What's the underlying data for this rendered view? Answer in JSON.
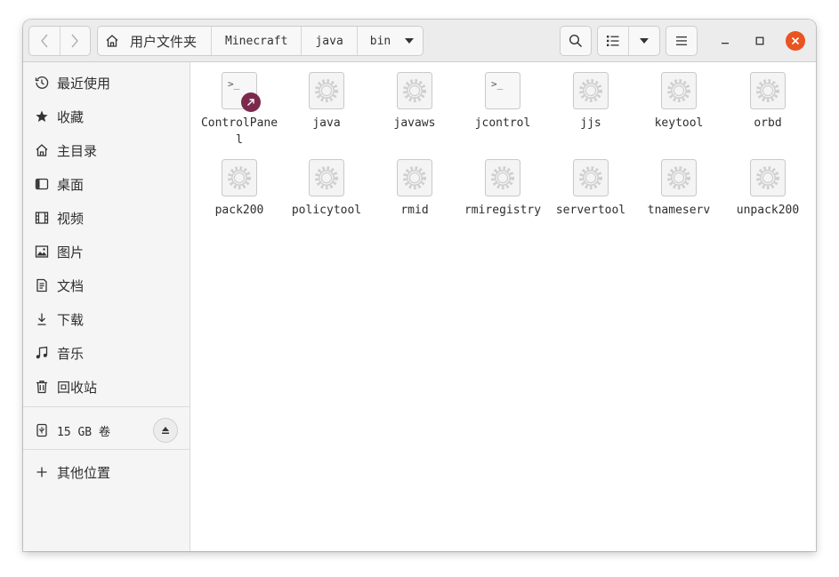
{
  "header": {
    "path": {
      "home_label": "用户文件夹",
      "segments": [
        "Minecraft",
        "java"
      ],
      "current": "bin"
    }
  },
  "sidebar": {
    "items": [
      {
        "label": "最近使用",
        "icon": "clock-icon"
      },
      {
        "label": "收藏",
        "icon": "star-icon"
      },
      {
        "label": "主目录",
        "icon": "home-icon"
      },
      {
        "label": "桌面",
        "icon": "desktop-icon"
      },
      {
        "label": "视频",
        "icon": "film-icon"
      },
      {
        "label": "图片",
        "icon": "image-icon"
      },
      {
        "label": "文档",
        "icon": "document-icon"
      },
      {
        "label": "下载",
        "icon": "download-icon"
      },
      {
        "label": "音乐",
        "icon": "music-icon"
      },
      {
        "label": "回收站",
        "icon": "trash-icon"
      }
    ],
    "volume": {
      "label": "15 GB 卷",
      "icon": "usb-drive-icon"
    },
    "other_locations": {
      "label": "其他位置",
      "icon": "plus-icon"
    }
  },
  "files": [
    {
      "name": "ControlPanel",
      "icon": "terminal-icon",
      "symlink": true
    },
    {
      "name": "java",
      "icon": "executable-icon"
    },
    {
      "name": "javaws",
      "icon": "executable-icon"
    },
    {
      "name": "jcontrol",
      "icon": "terminal-icon"
    },
    {
      "name": "jjs",
      "icon": "executable-icon"
    },
    {
      "name": "keytool",
      "icon": "executable-icon"
    },
    {
      "name": "orbd",
      "icon": "executable-icon"
    },
    {
      "name": "pack200",
      "icon": "executable-icon"
    },
    {
      "name": "policytool",
      "icon": "executable-icon"
    },
    {
      "name": "rmid",
      "icon": "executable-icon"
    },
    {
      "name": "rmiregistry",
      "icon": "executable-icon"
    },
    {
      "name": "servertool",
      "icon": "executable-icon"
    },
    {
      "name": "tnameserv",
      "icon": "executable-icon"
    },
    {
      "name": "unpack200",
      "icon": "executable-icon"
    }
  ],
  "colors": {
    "close": "#e95420",
    "symlink_badge": "#7b2a4d"
  }
}
